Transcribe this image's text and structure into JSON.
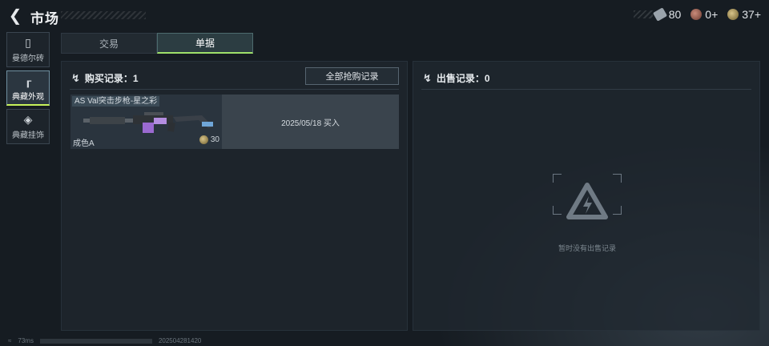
{
  "header": {
    "title": "市场",
    "currencies": [
      {
        "icon": "ticket-icon",
        "value": "80"
      },
      {
        "icon": "red-coin-icon",
        "value": "0+"
      },
      {
        "icon": "gold-coin-icon",
        "value": "37+"
      }
    ]
  },
  "nav": {
    "items": [
      {
        "label": "曼德尔砖",
        "icon": "brick-icon",
        "active": false
      },
      {
        "label": "典藏外观",
        "icon": "gun-icon",
        "active": true
      },
      {
        "label": "典藏挂饰",
        "icon": "charm-icon",
        "active": false
      }
    ]
  },
  "tabs": [
    {
      "label": "交易",
      "active": false
    },
    {
      "label": "单据",
      "active": true
    }
  ],
  "buy_panel": {
    "title": "购买记录：1",
    "all_button": "全部抢购记录",
    "records": [
      {
        "item_name": "AS Val突击步枪-星之彩",
        "grade": "成色A",
        "price": "30",
        "info": "2025/05/18 买入"
      }
    ]
  },
  "sell_panel": {
    "title": "出售记录：0",
    "empty_text": "暂时没有出售记录"
  },
  "footer": {
    "ping": "73ms",
    "build": "202504281420"
  }
}
